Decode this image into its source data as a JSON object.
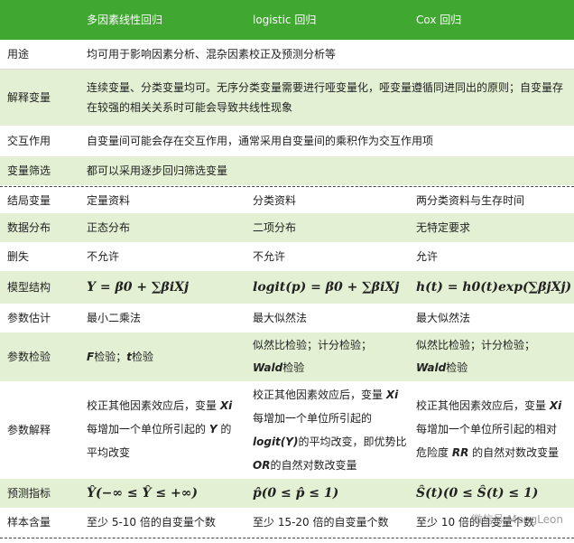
{
  "header": {
    "c1": "多因素线性回归",
    "c2": "logistic 回归",
    "c3": "Cox 回归"
  },
  "rows": {
    "purpose": {
      "label": "用途",
      "text": "均可用于影响因素分析、混杂因素校正及预测分析等"
    },
    "explain_var": {
      "label": "解释变量",
      "text": "连续变量、分类变量均可。无序分类变量需要进行哑变量化，哑变量遵循同进同出的原则；自变量存在较强的相关关系时可能会导致共线性现象"
    },
    "interaction": {
      "label": "交互作用",
      "text": "自变量间可能会存在交互作用，通常采用自变量间的乘积作为交互作用项"
    },
    "selection": {
      "label": "变量筛选",
      "text": "都可以采用逐步回归筛选变量"
    },
    "outcome": {
      "label": "结局变量",
      "c1": "定量资料",
      "c2": "分类资料",
      "c3": "两分类资料与生存时间"
    },
    "distribution": {
      "label": "数据分布",
      "c1": "正态分布",
      "c2": "二项分布",
      "c3": "无特定要求"
    },
    "censor": {
      "label": "删失",
      "c1": "不允许",
      "c2": "不允许",
      "c3": "允许"
    },
    "model": {
      "label": "模型结构",
      "c1": "Y = β0 + ∑βiXj",
      "c2": "logit(p) = β0 + ∑βiXj",
      "c3": "h(t) = h0(t)exp(∑βjXj)"
    },
    "estimate": {
      "label": "参数估计",
      "c1": "最小二乘法",
      "c2": "最大似然法",
      "c3": "最大似然法"
    },
    "test": {
      "label": "参数检验",
      "c1_f": "F",
      "c1_mid": "检验；",
      "c1_t": "t",
      "c1_end": "检验",
      "c2_line1": "似然比检验；计分检验；",
      "c2_wald": "Wald",
      "c2_end": "检验",
      "c3_line1": "似然比检验；计分检验；",
      "c3_wald": "Wald",
      "c3_end": "检验"
    },
    "interpret": {
      "label": "参数解释",
      "c1_a": "校正其他因素效应后，变量",
      "c1_x": "Xi",
      "c1_b": "每增加一个单位所引起的",
      "c1_y": "Y",
      "c1_c": "的",
      "c1_d": "平均改变",
      "c2_a": "校正其他因素效应后，变量",
      "c2_x": "Xi",
      "c2_b": "每增加一个单位所引起的",
      "c2_logit": "logit(Y)",
      "c2_c": "的平均改变，即优势比",
      "c2_or": "OR",
      "c2_d": "的自然对数改变量",
      "c3_a": "校正其他因素效应后，变量",
      "c3_x": "Xi",
      "c3_b": "每增加一个单位所引起的相对",
      "c3_c": "危险度",
      "c3_rr": "RR",
      "c3_d": "的自然对数改变量"
    },
    "predict": {
      "label": "预测指标",
      "c1": "Ŷ(−∞ ≤ Ŷ ≤ +∞)",
      "c2": "p̂(0 ≤ p̂ ≤ 1)",
      "c3": "Ŝ(t)(0 ≤ Ŝ(t) ≤ 1)"
    },
    "sample": {
      "label": "样本含量",
      "c1": "至少 5-10 倍的自变量个数",
      "c2": "至少 15-20 倍的自变量个数",
      "c3": "至少 10 倍的自变量个数"
    }
  },
  "watermark": "微信号 MengLeon",
  "colors": {
    "header": "#40a830",
    "shade": "#e3f0d3"
  }
}
